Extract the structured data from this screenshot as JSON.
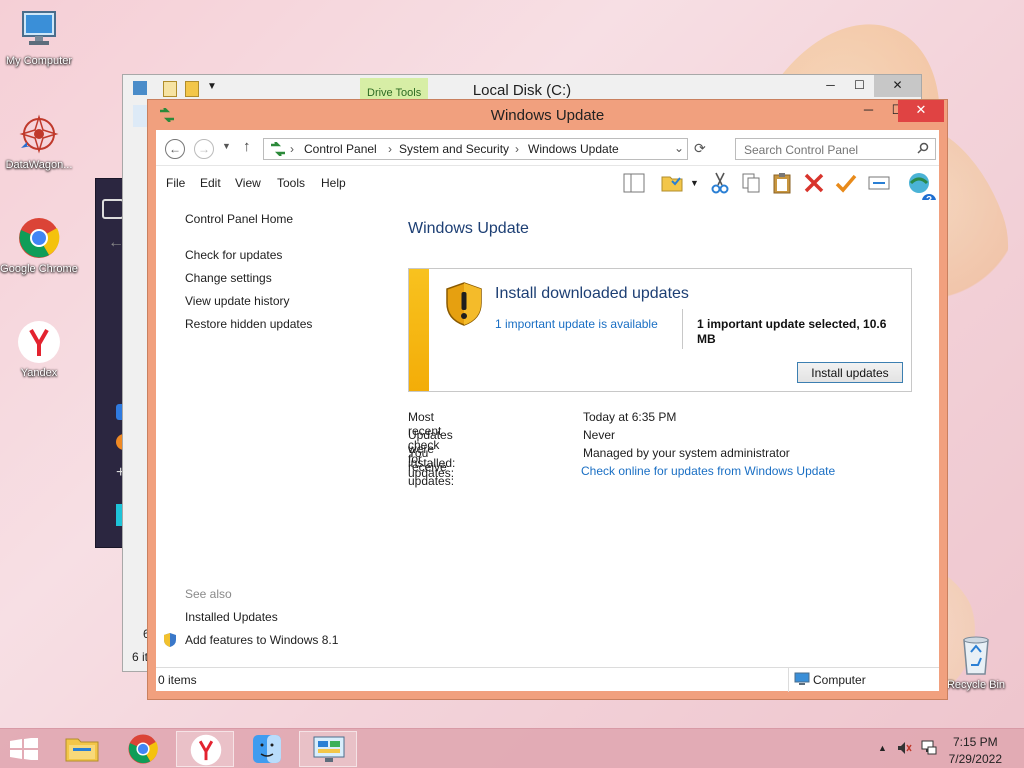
{
  "desktop": {
    "icons": [
      {
        "label": "My Computer"
      },
      {
        "label": "DataWagon..."
      },
      {
        "label": "Google Chrome"
      },
      {
        "label": "Yandex"
      },
      {
        "label": "Recycle Bin"
      }
    ]
  },
  "explorer_window": {
    "title": "Local Disk (C:)",
    "ribbon_tab": "Drive Tools",
    "status_fragment_top": "6",
    "status_fragment": "6 it"
  },
  "window": {
    "title": "Windows Update",
    "breadcrumb": [
      "Control Panel",
      "System and Security",
      "Windows Update"
    ],
    "search_placeholder": "Search Control Panel",
    "menu": [
      "File",
      "Edit",
      "View",
      "Tools",
      "Help"
    ]
  },
  "left_pane": {
    "home": "Control Panel Home",
    "links": [
      "Check for updates",
      "Change settings",
      "View update history",
      "Restore hidden updates"
    ],
    "see_also_label": "See also",
    "see_also": [
      "Installed Updates",
      "Add features to Windows 8.1"
    ]
  },
  "content": {
    "title": "Windows Update",
    "box": {
      "heading": "Install downloaded updates",
      "link": "1 important update is available",
      "selected": "1 important update selected, 10.6 MB",
      "button": "Install updates"
    },
    "info": [
      {
        "label": "Most recent check for updates:",
        "value": "Today at 6:35 PM"
      },
      {
        "label": "Updates were installed:",
        "value": "Never"
      },
      {
        "label": "You receive updates:",
        "value": "Managed by your system administrator"
      }
    ],
    "online_link": "Check online for updates from Windows Update"
  },
  "status_bar": {
    "items": "0 items",
    "location": "Computer"
  },
  "taskbar": {
    "time": "7:15 PM",
    "date": "7/29/2022"
  },
  "colors": {
    "window_frame": "#f1a07e",
    "close_button": "#e04343",
    "link": "#1a6fc4",
    "heading": "#1d3f74",
    "warning_bar": "#f3ad08"
  }
}
